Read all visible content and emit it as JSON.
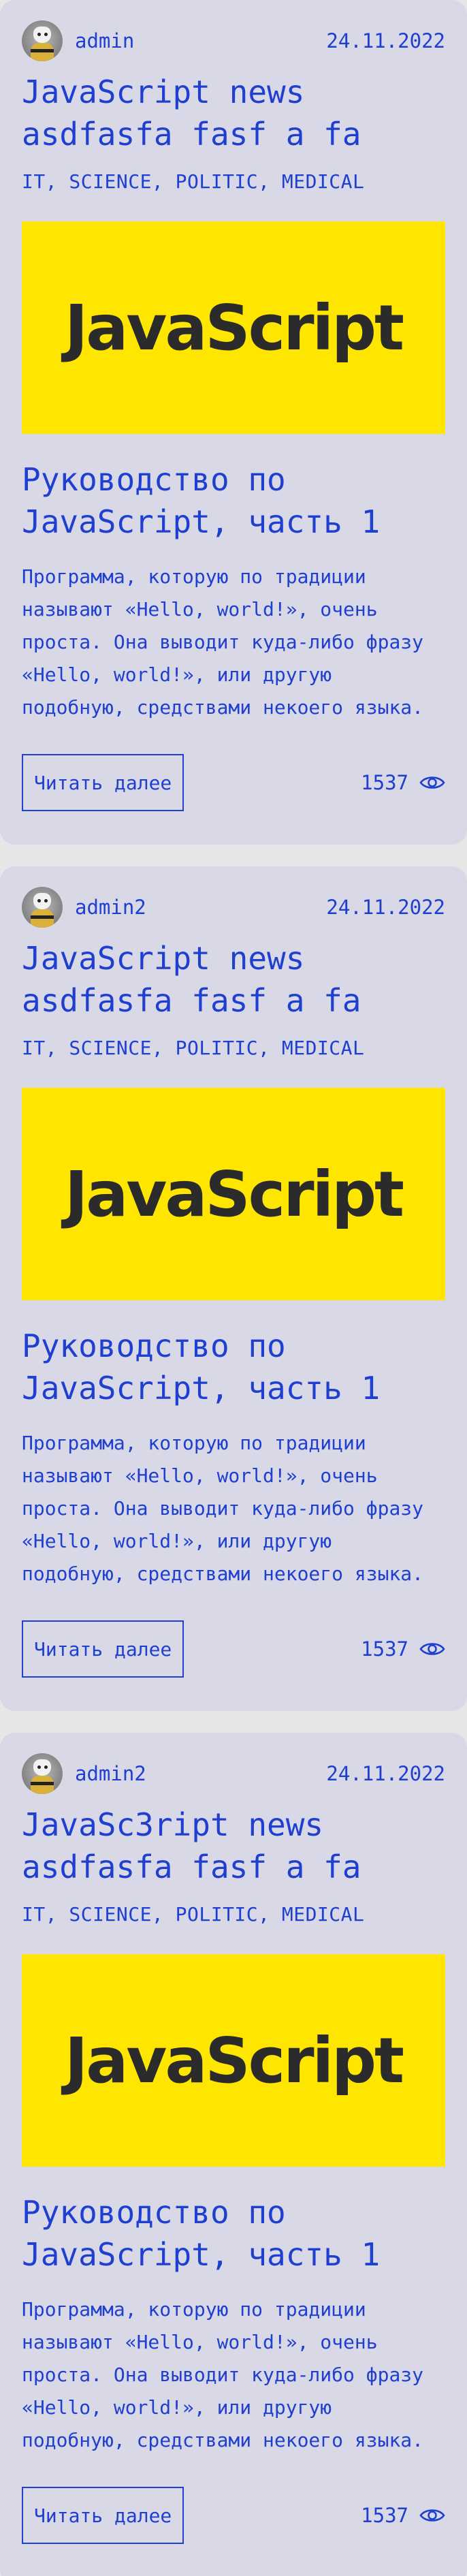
{
  "posts": [
    {
      "author": "admin",
      "date": "24.11.2022",
      "title": "JavaScript news\nasdfasfa fasf a fa",
      "tags": "IT, SCIENCE, POLITIC, MEDICAL",
      "banner_text": "JavaScript",
      "subtitle": "Руководство по JavaScript, часть 1",
      "excerpt": "Программа, которую по традиции называют «Hello, world!», очень проста. Она выводит куда-либо фразу «Hello, world!», или другую подобную, средствами некоего языка.",
      "read_more": "Читать далее",
      "views": "1537"
    },
    {
      "author": "admin2",
      "date": "24.11.2022",
      "title": "JavaScript news\nasdfasfa fasf a fa",
      "tags": "IT, SCIENCE, POLITIC, MEDICAL",
      "banner_text": "JavaScript",
      "subtitle": "Руководство по JavaScript, часть 1",
      "excerpt": "Программа, которую по традиции называют «Hello, world!», очень проста. Она выводит куда-либо фразу «Hello, world!», или другую подобную, средствами некоего языка.",
      "read_more": "Читать далее",
      "views": "1537"
    },
    {
      "author": "admin2",
      "date": "24.11.2022",
      "title": "JavaSc3ript news\nasdfasfa fasf a fa",
      "tags": "IT, SCIENCE, POLITIC, MEDICAL",
      "banner_text": "JavaScript",
      "subtitle": "Руководство по JavaScript, часть 1",
      "excerpt": "Программа, которую по традиции называют «Hello, world!», очень проста. Она выводит куда-либо фразу «Hello, world!», или другую подобную, средствами некоего языка.",
      "read_more": "Читать далее",
      "views": "1537"
    }
  ],
  "colors": {
    "accent": "#1f3fd1",
    "card_bg": "#d8d8e6",
    "page_bg": "#e6e6e6",
    "banner_bg": "#ffe600"
  },
  "icons": {
    "avatar": "avatar-image",
    "views": "eye-icon"
  }
}
